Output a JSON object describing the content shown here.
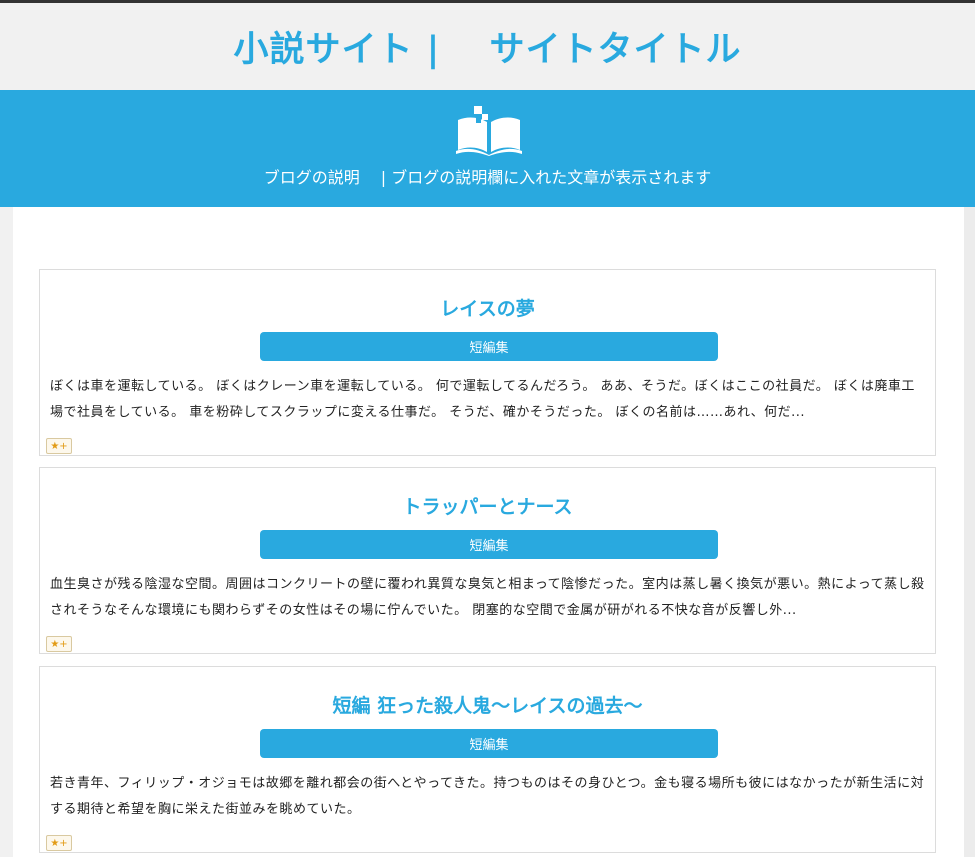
{
  "header": {
    "site_title": "小説サイト |　 サイトタイトル"
  },
  "banner": {
    "icon": "open-book-icon",
    "description": "ブログの説明　 | ブログの説明欄に入れた文章が表示されます"
  },
  "colors": {
    "accent": "#29a9df",
    "background": "#f1f1f1"
  },
  "articles": [
    {
      "title": "レイスの夢",
      "category": "短編集",
      "excerpt": "ぼくは車を運転している。 ぼくはクレーン車を運転している。 何で運転してるんだろう。 ああ、そうだ。ぼくはここの社員だ。 ぼくは廃車工場で社員をしている。 車を粉砕してスクラップに変える仕事だ。 そうだ、確かそうだった。 ぼくの名前は……あれ、何だ...",
      "star_label": "★+"
    },
    {
      "title": "トラッパーとナース",
      "category": "短編集",
      "excerpt": "血生臭さが残る陰湿な空間。周囲はコンクリートの壁に覆われ異質な臭気と相まって陰惨だった。室内は蒸し暑く換気が悪い。熱によって蒸し殺されそうなそんな環境にも関わらずその女性はその場に佇んでいた。 閉塞的な空間で金属が研がれる不快な音が反響し外...",
      "star_label": "★+"
    },
    {
      "title": "短編 狂った殺人鬼～レイスの過去～",
      "category": "短編集",
      "excerpt": "若き青年、フィリップ・オジョモは故郷を離れ都会の街へとやってきた。持つものはその身ひとつ。金も寝る場所も彼にはなかったが新生活に対する期待と希望を胸に栄えた街並みを眺めていた。",
      "star_label": "★+"
    }
  ]
}
